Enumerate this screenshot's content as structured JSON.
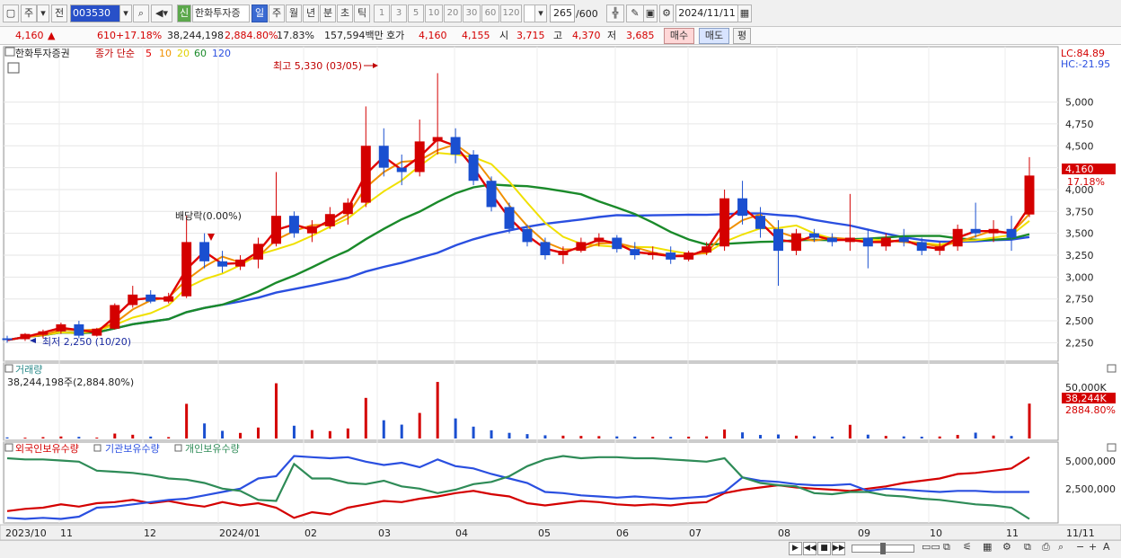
{
  "toolbar": {
    "period_prefix": "주",
    "prev_label": "전",
    "stock_code": "003530",
    "new_label": "신",
    "stock_name": "한화투자증",
    "period_buttons": [
      "일",
      "주",
      "월",
      "년",
      "분",
      "초",
      "틱"
    ],
    "active_period": "일",
    "interval_buttons": [
      "1",
      "3",
      "5",
      "10",
      "20",
      "30",
      "60",
      "120"
    ],
    "count": "265",
    "count_total": "/600",
    "date": "2024/11/11"
  },
  "quote": {
    "price": "4,160",
    "change_arrow": "▲",
    "change": "610",
    "change_pct": "+17.18%",
    "volume": "38,244,198",
    "volume_ratio": "2,884.80%",
    "turnover": "17.83%",
    "amount": "157,594백만",
    "ask_label": "호가",
    "ask_price": "4,160",
    "bid_price": "4,155",
    "open_label": "시",
    "open": "3,715",
    "high_label": "고",
    "high": "4,370",
    "low_label": "저",
    "low": "3,685",
    "buy_label": "매수",
    "sell_label": "매도",
    "eval_label": "평"
  },
  "panel_price": {
    "title": "한화투자증권",
    "ma_label": "종가 단순",
    "ma_periods": [
      "5",
      "10",
      "20",
      "60",
      "120"
    ],
    "ma_colors": [
      "#e00000",
      "#f09000",
      "#f0e000",
      "#1a8a2a",
      "#2a4fe0"
    ],
    "high_note": "최고 5,330 (03/05)",
    "low_note": "최저 2,250 (10/20)",
    "dividend_note": "배당락(0.00%)",
    "lc": "LC:84.89",
    "hc": "HC:-21.95",
    "last_price_tag": "4,160",
    "last_pct_tag": "17.18%"
  },
  "panel_volume": {
    "title": "거래량",
    "value": "38,244,198주(2,884.80%)",
    "axis_label": "50,000K",
    "last_tag": "38,244K",
    "last_pct_tag": "2884.80%"
  },
  "panel_holdings": {
    "legend": [
      "외국인보유수량",
      "기관보유수량",
      "개인보유수량"
    ],
    "legend_colors": [
      "#d40000",
      "#2a4fe0",
      "#2e8b57"
    ],
    "axis": [
      "5,000,000",
      "2,500,000"
    ]
  },
  "x_labels": [
    "2023/10",
    "11",
    "12",
    "2024/01",
    "02",
    "03",
    "04",
    "05",
    "06",
    "07",
    "08",
    "09",
    "10",
    "11"
  ],
  "x_right_label": "11/11",
  "chart_data": {
    "type": "candlestick",
    "price_axis": [
      "5,000",
      "4,750",
      "4,500",
      "4,250",
      "4,000",
      "3,750",
      "3,500",
      "3,250",
      "3,000",
      "2,750",
      "2,500",
      "2,250"
    ],
    "ylim": [
      2100,
      5550
    ],
    "candles": [
      [
        2300,
        2330,
        2250,
        2280
      ],
      [
        2290,
        2360,
        2270,
        2350
      ],
      [
        2340,
        2400,
        2300,
        2380
      ],
      [
        2380,
        2480,
        2350,
        2460
      ],
      [
        2460,
        2500,
        2300,
        2330
      ],
      [
        2330,
        2420,
        2320,
        2410
      ],
      [
        2410,
        2700,
        2400,
        2680
      ],
      [
        2680,
        2900,
        2650,
        2800
      ],
      [
        2800,
        2850,
        2700,
        2720
      ],
      [
        2720,
        2820,
        2700,
        2780
      ],
      [
        2780,
        3700,
        2760,
        3400
      ],
      [
        3400,
        3500,
        3100,
        3180
      ],
      [
        3180,
        3300,
        3050,
        3120
      ],
      [
        3120,
        3250,
        3080,
        3200
      ],
      [
        3200,
        3450,
        3100,
        3380
      ],
      [
        3380,
        4200,
        3350,
        3700
      ],
      [
        3700,
        3750,
        3450,
        3500
      ],
      [
        3500,
        3650,
        3400,
        3580
      ],
      [
        3580,
        3800,
        3550,
        3720
      ],
      [
        3720,
        3900,
        3600,
        3850
      ],
      [
        3850,
        4950,
        3800,
        4500
      ],
      [
        4500,
        4700,
        4150,
        4250
      ],
      [
        4250,
        4400,
        4050,
        4200
      ],
      [
        4200,
        4800,
        4150,
        4550
      ],
      [
        4550,
        5330,
        4400,
        4600
      ],
      [
        4600,
        4700,
        4300,
        4400
      ],
      [
        4400,
        4450,
        4050,
        4100
      ],
      [
        4100,
        4150,
        3750,
        3800
      ],
      [
        3800,
        3850,
        3500,
        3550
      ],
      [
        3550,
        3600,
        3350,
        3400
      ],
      [
        3400,
        3450,
        3200,
        3250
      ],
      [
        3250,
        3350,
        3150,
        3300
      ],
      [
        3300,
        3450,
        3280,
        3400
      ],
      [
        3400,
        3500,
        3350,
        3450
      ],
      [
        3450,
        3480,
        3280,
        3320
      ],
      [
        3320,
        3400,
        3200,
        3250
      ],
      [
        3250,
        3350,
        3200,
        3280
      ],
      [
        3280,
        3350,
        3150,
        3200
      ],
      [
        3200,
        3300,
        3180,
        3280
      ],
      [
        3280,
        3400,
        3250,
        3350
      ],
      [
        3350,
        4000,
        3300,
        3900
      ],
      [
        3900,
        4100,
        3600,
        3700
      ],
      [
        3700,
        3800,
        3450,
        3550
      ],
      [
        3550,
        3650,
        2900,
        3300
      ],
      [
        3300,
        3550,
        3250,
        3500
      ],
      [
        3500,
        3550,
        3400,
        3450
      ],
      [
        3450,
        3500,
        3350,
        3400
      ],
      [
        3400,
        3950,
        3300,
        3450
      ],
      [
        3450,
        3550,
        3100,
        3350
      ],
      [
        3350,
        3500,
        3300,
        3450
      ],
      [
        3450,
        3550,
        3350,
        3400
      ],
      [
        3400,
        3450,
        3250,
        3300
      ],
      [
        3300,
        3400,
        3250,
        3350
      ],
      [
        3350,
        3600,
        3300,
        3550
      ],
      [
        3550,
        3850,
        3450,
        3500
      ],
      [
        3500,
        3650,
        3400,
        3550
      ],
      [
        3550,
        3700,
        3300,
        3450
      ],
      [
        3715,
        4370,
        3685,
        4160
      ]
    ],
    "volume_max_k": 65000,
    "volume_k": [
      1200,
      900,
      1500,
      2200,
      1800,
      1000,
      5400,
      4100,
      2100,
      1500,
      38000,
      16500,
      8400,
      6100,
      12000,
      60500,
      14000,
      9200,
      8100,
      11000,
      44500,
      20000,
      15200,
      28000,
      62000,
      22000,
      13000,
      9000,
      6200,
      4800,
      3500,
      3100,
      2800,
      2600,
      2300,
      2100,
      1900,
      1800,
      2000,
      2300,
      9800,
      6700,
      3900,
      4400,
      3100,
      2500,
      2100,
      15000,
      4200,
      2800,
      2300,
      2000,
      2200,
      3900,
      6400,
      3200,
      2800,
      38244
    ],
    "holdings": [
      {
        "name": "외국인보유수량",
        "values": [
          900000,
          1100000,
          1200000,
          1500000,
          1300000,
          1600000,
          1700000,
          1900000,
          1600000,
          1800000,
          1500000,
          1300000,
          1700000,
          1400000,
          1600000,
          1200000,
          300000,
          800000,
          600000,
          1200000,
          1500000,
          1800000,
          1700000,
          2000000,
          2200000,
          2500000,
          2700000,
          2400000,
          2200000,
          1600000,
          1400000,
          1600000,
          1800000,
          1700000,
          1500000,
          1400000,
          1500000,
          1400000,
          1600000,
          1700000,
          2500000,
          2800000,
          3000000,
          3200000,
          3000000,
          2900000,
          2800000,
          2700000,
          2900000,
          3100000,
          3400000,
          3600000,
          3800000,
          4200000,
          4300000,
          4500000,
          4700000,
          5700000
        ]
      },
      {
        "name": "기관보유수량",
        "values": [
          300000,
          200000,
          300000,
          200000,
          400000,
          1200000,
          1300000,
          1500000,
          1700000,
          1900000,
          2000000,
          2300000,
          2600000,
          2900000,
          3800000,
          4000000,
          5800000,
          5700000,
          5600000,
          5700000,
          5300000,
          5000000,
          5200000,
          4800000,
          5500000,
          4900000,
          4700000,
          4200000,
          3800000,
          3400000,
          2600000,
          2500000,
          2300000,
          2200000,
          2100000,
          2200000,
          2100000,
          2000000,
          2100000,
          2200000,
          2600000,
          3900000,
          3600000,
          3500000,
          3300000,
          3200000,
          3200000,
          3300000,
          2700000,
          2900000,
          2800000,
          2700000,
          2600000,
          2700000,
          2700000,
          2600000,
          2600000,
          2600000
        ]
      },
      {
        "name": "개인보유수량",
        "values": [
          5600000,
          5500000,
          5500000,
          5400000,
          5300000,
          4500000,
          4400000,
          4300000,
          4100000,
          3800000,
          3700000,
          3400000,
          2900000,
          2700000,
          1900000,
          1800000,
          5100000,
          3800000,
          3800000,
          3400000,
          3300000,
          3600000,
          3100000,
          2900000,
          2500000,
          2800000,
          3300000,
          3500000,
          4000000,
          4900000,
          5500000,
          5800000,
          5600000,
          5700000,
          5700000,
          5600000,
          5600000,
          5500000,
          5400000,
          5300000,
          5600000,
          3900000,
          3400000,
          3200000,
          3100000,
          2500000,
          2400000,
          2600000,
          2600000,
          2300000,
          2200000,
          2000000,
          1900000,
          1700000,
          1500000,
          1400000,
          1200000,
          200000
        ]
      }
    ],
    "holdings_max": 6000000
  }
}
